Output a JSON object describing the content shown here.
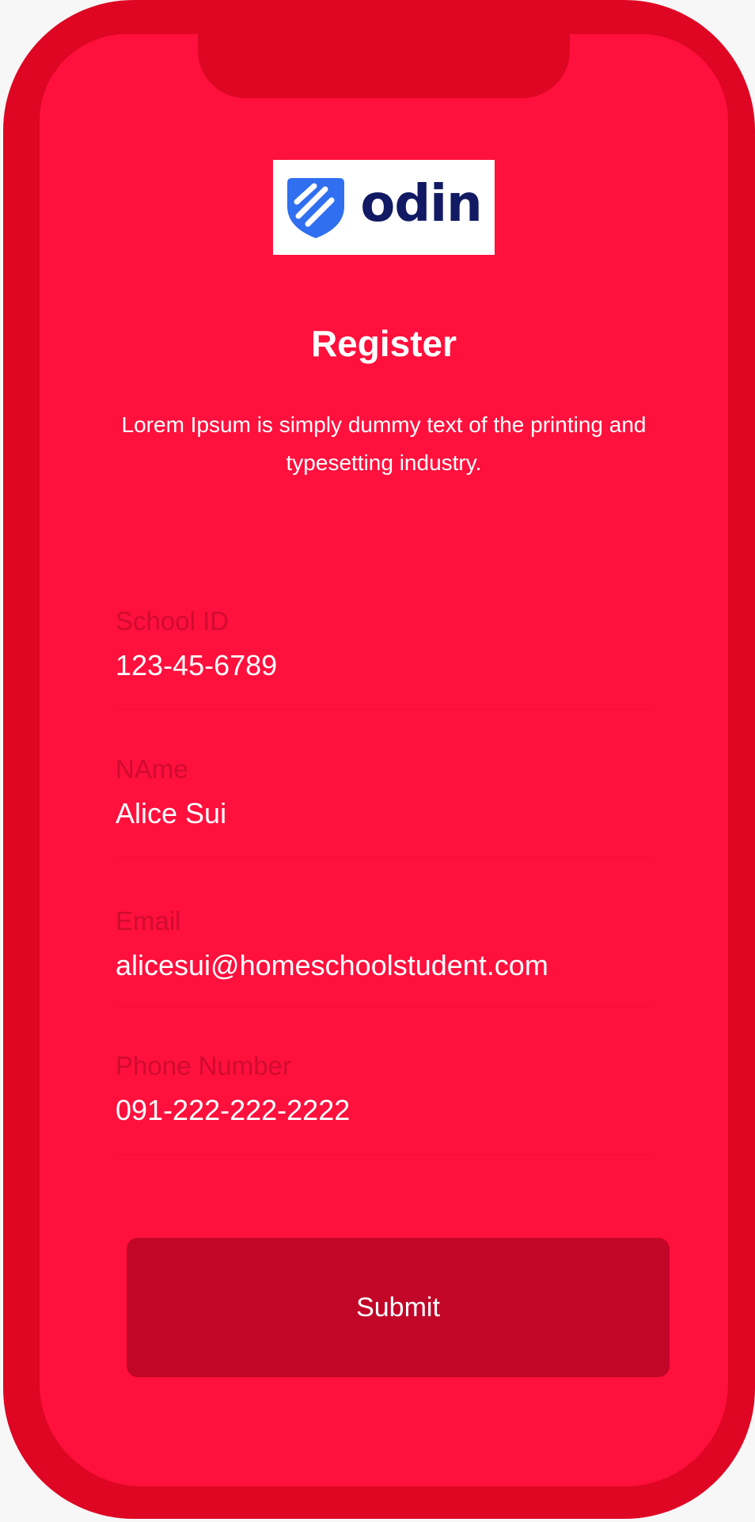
{
  "logo": {
    "text": "odin",
    "icon": "shield-icon"
  },
  "header": {
    "title": "Register",
    "subtitle": "Lorem Ipsum is simply dummy text of the printing and typesetting industry."
  },
  "form": {
    "fields": [
      {
        "label": "School ID",
        "value": "123-45-6789"
      },
      {
        "label": "NAme",
        "value": "Alice Sui"
      },
      {
        "label": "Email",
        "value": "alicesui@homeschoolstudent.com"
      },
      {
        "label": "Phone Number",
        "value": "091-222-222-2222"
      }
    ],
    "submit_label": "Submit"
  },
  "colors": {
    "frame": "#de0623",
    "screen": "#ff103d",
    "button": "#c20628",
    "label": "#d00b2f",
    "logo_text": "#111a63",
    "logo_icon": "#2f6ff0"
  }
}
